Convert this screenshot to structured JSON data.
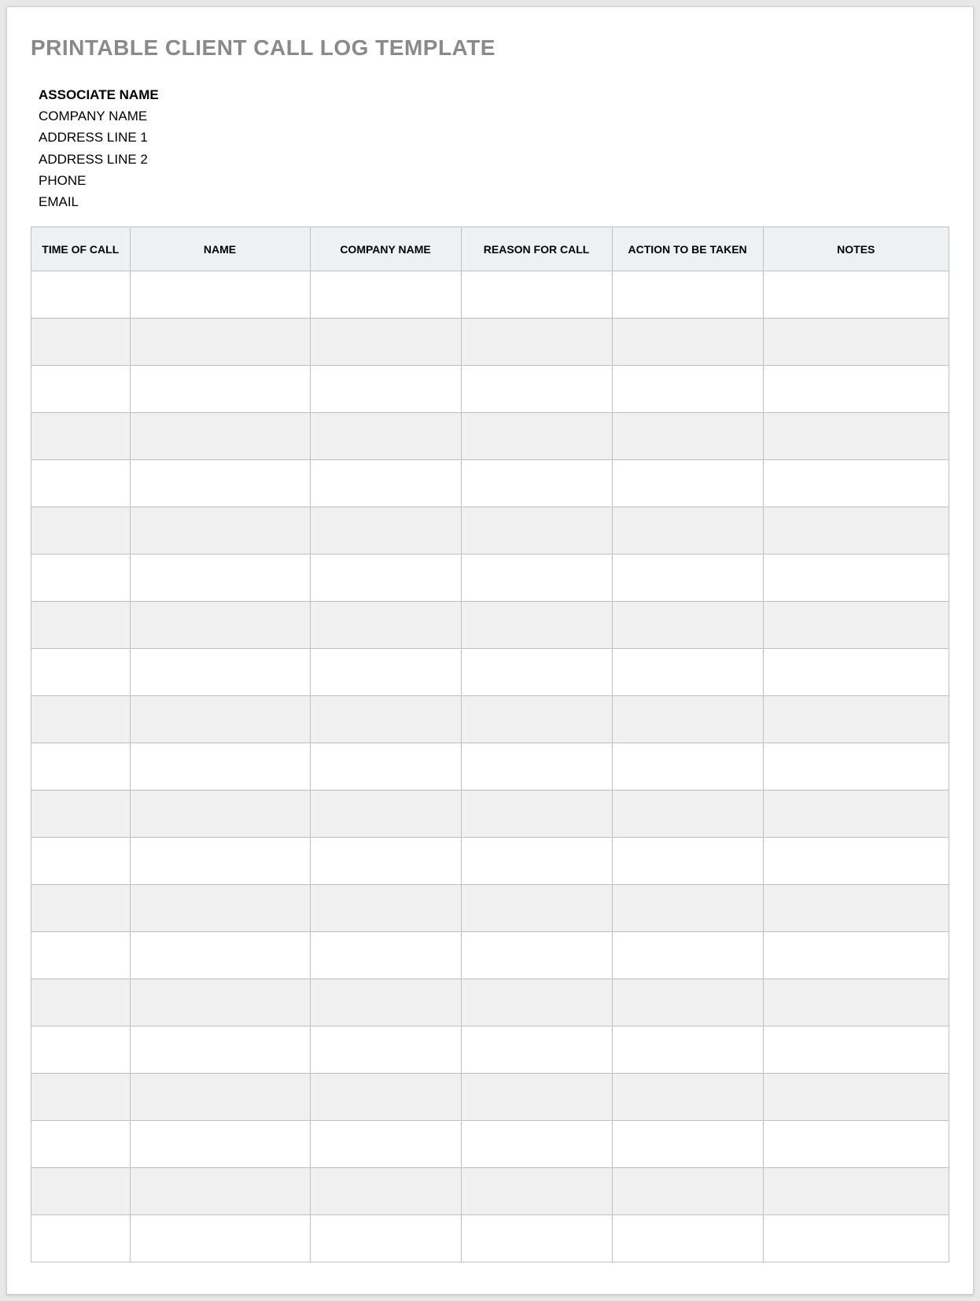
{
  "title": "PRINTABLE CLIENT CALL LOG TEMPLATE",
  "info": {
    "associate": "ASSOCIATE NAME",
    "company": "COMPANY NAME",
    "address1": "ADDRESS LINE 1",
    "address2": "ADDRESS LINE 2",
    "phone": "PHONE",
    "email": "EMAIL"
  },
  "columns": {
    "time": "TIME OF CALL",
    "name": "NAME",
    "company": "COMPANY NAME",
    "reason": "REASON FOR CALL",
    "action": "ACTION TO BE TAKEN",
    "notes": "NOTES"
  },
  "row_count": 21
}
